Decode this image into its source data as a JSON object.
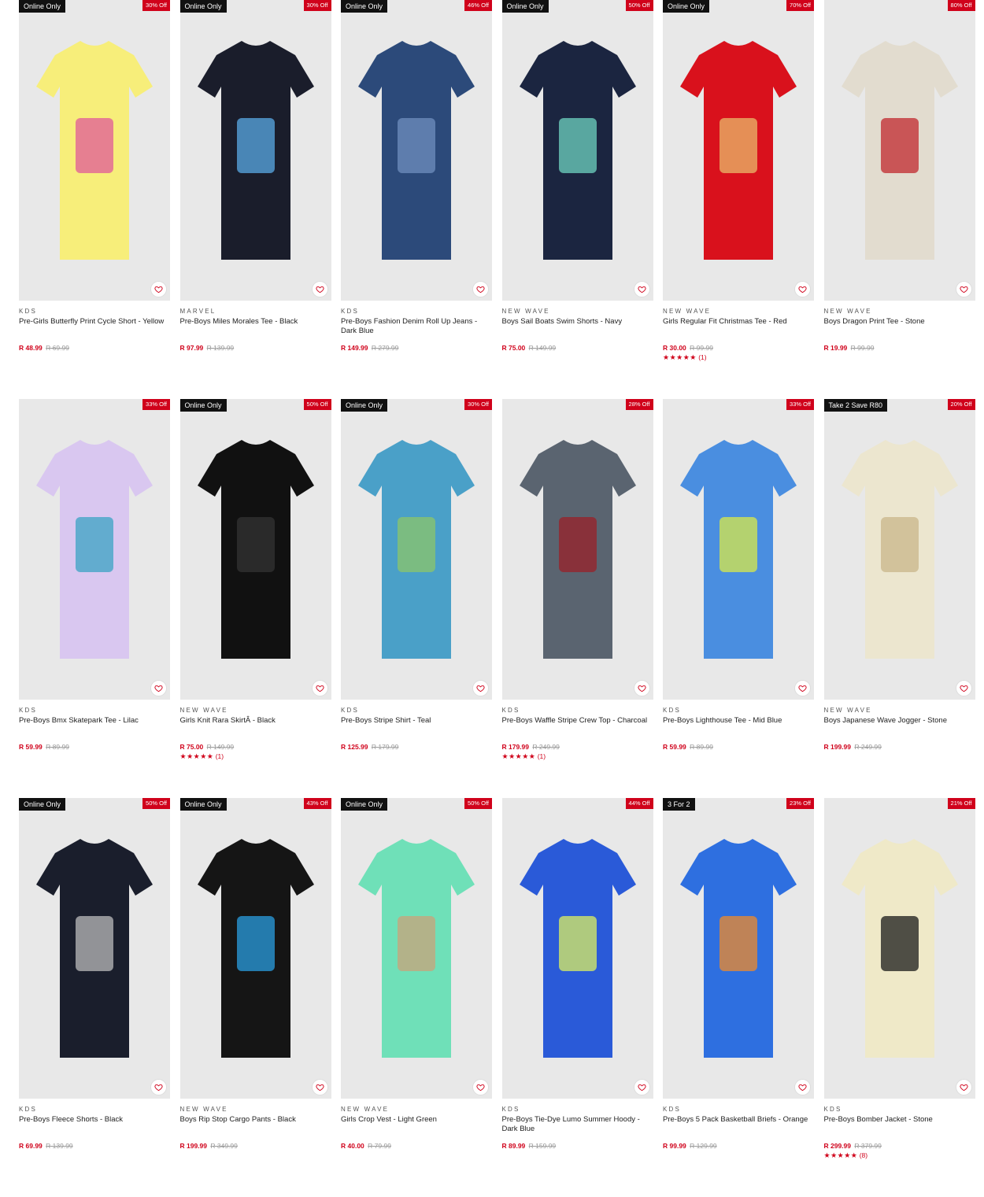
{
  "products": [
    {
      "tag": "Online Only",
      "discount": "30% Off",
      "brand": "KDS",
      "name": "Pre-Girls Butterfly Print Cycle Short - Yellow",
      "price": "R 48.99",
      "was": "R 69.99",
      "stars": "",
      "reviews": "",
      "bg": "#f7ee7a",
      "accent": "#e05a9a"
    },
    {
      "tag": "Online Only",
      "discount": "30% Off",
      "brand": "MARVEL",
      "name": "Pre-Boys Miles Morales Tee - Black",
      "price": "R 97.99",
      "was": "R 139.99",
      "stars": "",
      "reviews": "",
      "bg": "#1a1d2b",
      "accent": "#5aa9e6"
    },
    {
      "tag": "Online Only",
      "discount": "46% Off",
      "brand": "KDS",
      "name": "Pre-Boys Fashion Denim Roll Up Jeans - Dark Blue",
      "price": "R 149.99",
      "was": "R 279.99",
      "stars": "",
      "reviews": "",
      "bg": "#2c4a7a",
      "accent": "#6f8fbf"
    },
    {
      "tag": "Online Only",
      "discount": "50% Off",
      "brand": "NEW WAVE",
      "name": "Boys Sail Boats Swim Shorts - Navy",
      "price": "R 75.00",
      "was": "R 149.99",
      "stars": "",
      "reviews": "",
      "bg": "#1b2540",
      "accent": "#6fd3c0"
    },
    {
      "tag": "Online Only",
      "discount": "70% Off",
      "brand": "NEW WAVE",
      "name": "Girls Regular Fit Christmas Tee - Red",
      "price": "R 30.00",
      "was": "R 99.99",
      "stars": "★★★★★",
      "reviews": "(1)",
      "bg": "#d9111c",
      "accent": "#e8b96a"
    },
    {
      "tag": "",
      "discount": "80% Off",
      "brand": "NEW WAVE",
      "name": "Boys Dragon Print Tee - Stone",
      "price": "R 19.99",
      "was": "R 99.99",
      "stars": "",
      "reviews": "",
      "bg": "#e2dccf",
      "accent": "#c0282d"
    },
    {
      "tag": "",
      "discount": "33% Off",
      "brand": "KDS",
      "name": "Pre-Boys Bmx Skatepark Tee - Lilac",
      "price": "R 59.99",
      "was": "R 89.99",
      "stars": "",
      "reviews": "",
      "bg": "#d9c7f0",
      "accent": "#3aa3c4"
    },
    {
      "tag": "Online Only",
      "discount": "50% Off",
      "brand": "NEW WAVE",
      "name": "Girls Knit Rara SkirtÂ  - Black",
      "price": "R 75.00",
      "was": "R 149.99",
      "stars": "★★★★★",
      "reviews": "(1)",
      "bg": "#111111",
      "accent": "#333333"
    },
    {
      "tag": "Online Only",
      "discount": "30% Off",
      "brand": "KDS",
      "name": "Pre-Boys Stripe Shirt - Teal",
      "price": "R 125.99",
      "was": "R 179.99",
      "stars": "",
      "reviews": "",
      "bg": "#4aa0c8",
      "accent": "#8cc66a"
    },
    {
      "tag": "",
      "discount": "28% Off",
      "brand": "KDS",
      "name": "Pre-Boys Waffle Stripe Crew Top - Charcoal",
      "price": "R 179.99",
      "was": "R 249.99",
      "stars": "★★★★★",
      "reviews": "(1)",
      "bg": "#5a6470",
      "accent": "#9a2028"
    },
    {
      "tag": "",
      "discount": "33% Off",
      "brand": "KDS",
      "name": "Pre-Boys Lighthouse Tee - Mid Blue",
      "price": "R 59.99",
      "was": "R 89.99",
      "stars": "",
      "reviews": "",
      "bg": "#4a8ee0",
      "accent": "#d8e84a"
    },
    {
      "tag": "Take 2 Save R80",
      "discount": "20% Off",
      "brand": "NEW WAVE",
      "name": "Boys Japanese Wave Jogger - Stone",
      "price": "R 199.99",
      "was": "R 249.99",
      "stars": "",
      "reviews": "",
      "bg": "#ece6cf",
      "accent": "#c9b58a"
    },
    {
      "tag": "Online Only",
      "discount": "50% Off",
      "brand": "KDS",
      "name": "Pre-Boys Fleece Shorts - Black",
      "price": "R 69.99",
      "was": "R 139.99",
      "stars": "",
      "reviews": "",
      "bg": "#1a1e2c",
      "accent": "#bbbbbb"
    },
    {
      "tag": "Online Only",
      "discount": "43% Off",
      "brand": "NEW WAVE",
      "name": "Boys Rip Stop Cargo Pants - Black",
      "price": "R 199.99",
      "was": "R 349.99",
      "stars": "",
      "reviews": "",
      "bg": "#151515",
      "accent": "#2a9ee0"
    },
    {
      "tag": "Online Only",
      "discount": "50% Off",
      "brand": "NEW WAVE",
      "name": "Girls Crop Vest - Light Green",
      "price": "R 40.00",
      "was": "R 79.99",
      "stars": "",
      "reviews": "",
      "bg": "#6fe0b8",
      "accent": "#c9a37a"
    },
    {
      "tag": "",
      "discount": "44% Off",
      "brand": "KDS",
      "name": "Pre-Boys Tie-Dye Lumo Summer Hoody - Dark Blue",
      "price": "R 89.99",
      "was": "R 159.99",
      "stars": "",
      "reviews": "",
      "bg": "#2a5ad8",
      "accent": "#dcf060"
    },
    {
      "tag": "3 For 2",
      "discount": "23% Off",
      "brand": "KDS",
      "name": "Pre-Boys 5 Pack Basketball Briefs - Orange",
      "price": "R 99.99",
      "was": "R 129.99",
      "stars": "",
      "reviews": "",
      "bg": "#2e6fe0",
      "accent": "#f08a2a"
    },
    {
      "tag": "",
      "discount": "21% Off",
      "brand": "KDS",
      "name": "Pre-Boys Bomber Jacket - Stone",
      "price": "R 299.99",
      "was": "R 379.99",
      "stars": "★★★★★",
      "reviews": "(8)",
      "bg": "#efe9c8",
      "accent": "#1a1a1a"
    }
  ],
  "icons": {
    "favourite": "heart-icon"
  },
  "colors": {
    "sale_red": "#d0021b",
    "tag_black": "#111111"
  }
}
